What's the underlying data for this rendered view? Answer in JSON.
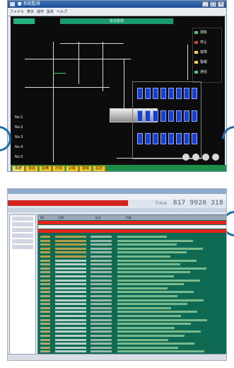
{
  "window1": {
    "title": "■ 系統監視",
    "toolbar": [
      "ファイル",
      "表示",
      "操作",
      "設定",
      "ヘルプ"
    ],
    "screen_title": "総合監視",
    "status": [
      {
        "label": "運転",
        "color": "#3ed36b"
      },
      {
        "label": "停止",
        "color": "#e03b2c"
      },
      {
        "label": "故障",
        "color": "#ffd23a"
      },
      {
        "label": "警報",
        "color": "#ffd23a"
      },
      {
        "label": "通信",
        "color": "#3ed36b"
      }
    ],
    "feeders": [
      "No.1",
      "No.2",
      "No.3",
      "No.4",
      "No.5"
    ],
    "tabs": [
      "系統",
      "電源",
      "設備",
      "計測",
      "記録",
      "警報",
      "設定"
    ]
  },
  "window2": {
    "counter_label": "Time",
    "counter_values": [
      "817",
      "9920",
      "318"
    ],
    "log_columns": [
      "No",
      "日時",
      "区分",
      "内容"
    ]
  },
  "colors": {
    "alarm": "#e0241c",
    "log_bg": "#0f6a54",
    "module": "#1a3fc8",
    "accent": "#1b6ea8"
  }
}
